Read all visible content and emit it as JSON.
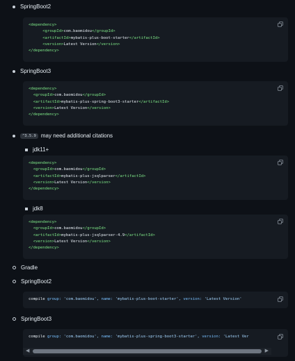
{
  "items": {
    "sb2": "SpringBoot2",
    "sb3": "SpringBoot3",
    "jsql_version": "^3.5.9",
    "jsql_note": "may need additional citations",
    "jdk11": "jdk11+",
    "jdk8": "jdk8",
    "gradle": "Gradle",
    "g_sb2": "SpringBoot2",
    "g_sb3": "SpringBoot3"
  },
  "code": {
    "groupId": "com.baomidou",
    "version": "Latest Version",
    "sb2_artifact": "mybatis-plus-boot-starter",
    "sb3_artifact": "mybatis-plus-spring-boot3-starter",
    "jdk11_artifact": "mybatis-plus-jsqlparser",
    "jdk8_artifact": "mybatis-plus-jsqlparser-4.9",
    "tags": {
      "dependency_open": "<dependency>",
      "dependency_close": "</dependency>",
      "groupId_open": "<groupId>",
      "groupId_close": "</groupId>",
      "artifactId_open": "<artifactId>",
      "artifactId_close": "</artifactId>",
      "version_open": "<version>",
      "version_close": "</version>"
    },
    "gradle": {
      "compile": "compile",
      "group_key": "group:",
      "name_key": "name:",
      "version_key": "version:",
      "group_val": "'com.baomidou',",
      "sb2_name_val": "'mybatis-plus-boot-starter',",
      "sb3_name_val": "'mybatis-plus-spring-boot3-starter',",
      "version_val": "'Latest Version'",
      "version_val_cut": "'Latest Ver"
    }
  },
  "icons": {
    "copy": "copy-icon",
    "scroll_left": "chevron-left-icon",
    "scroll_right": "chevron-right-icon"
  },
  "colors": {
    "background": "#0d1117",
    "code_bg": "#161b22",
    "tag": "#7ee787",
    "key": "#79c0ff"
  }
}
